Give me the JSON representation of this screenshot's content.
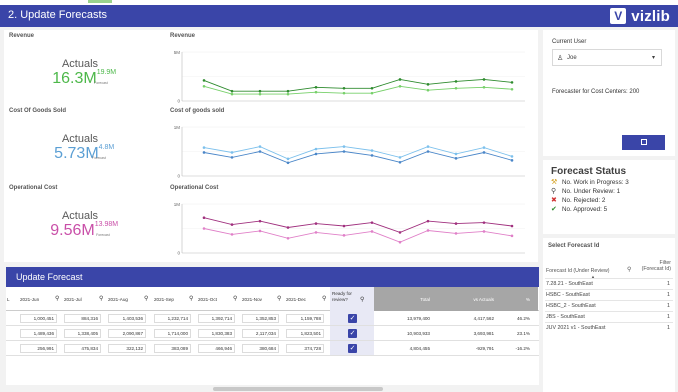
{
  "header": {
    "title": "2. Update Forecasts",
    "logo_text": "vizlib",
    "logo_glyph": "V"
  },
  "kpis": [
    {
      "section": "Revenue",
      "caption": "Actuals",
      "value": "16.3M",
      "forecast": "19.9M",
      "forecast_label": "Forecast",
      "color": "#4db84a"
    },
    {
      "section": "Cost Of Goods Sold",
      "caption": "Actuals",
      "value": "5.73M",
      "forecast": "4.8M",
      "forecast_label": "Forecast",
      "color": "#5b9fd4"
    },
    {
      "section": "Operational Cost",
      "caption": "Actuals",
      "value": "9.56M",
      "forecast": "13.98M",
      "forecast_label": "Forecast",
      "color": "#c94fa8"
    }
  ],
  "chart_data": [
    {
      "type": "line",
      "title": "Revenue",
      "ytick_top": "5M",
      "ytick_bottom": "0",
      "ylim": [
        0,
        5
      ],
      "series": [
        {
          "values": [
            2.1,
            1.0,
            1.0,
            1.0,
            1.4,
            1.3,
            1.3,
            2.2,
            1.7,
            2.0,
            2.2,
            1.9
          ],
          "color": "#2e8b2e"
        },
        {
          "values": [
            1.5,
            0.7,
            0.7,
            0.7,
            0.9,
            0.8,
            0.8,
            1.5,
            1.1,
            1.3,
            1.4,
            1.2
          ],
          "color": "#77d06a"
        }
      ]
    },
    {
      "type": "line",
      "title": "Cost of goods sold",
      "ytick_top": "1M",
      "ytick_bottom": "0",
      "ylim": [
        0,
        1
      ],
      "series": [
        {
          "values": [
            0.58,
            0.48,
            0.6,
            0.35,
            0.55,
            0.6,
            0.52,
            0.38,
            0.6,
            0.45,
            0.58,
            0.4
          ],
          "color": "#7cc0ec"
        },
        {
          "values": [
            0.48,
            0.38,
            0.5,
            0.27,
            0.45,
            0.5,
            0.42,
            0.28,
            0.5,
            0.36,
            0.48,
            0.32
          ],
          "color": "#4a86c8"
        }
      ]
    },
    {
      "type": "line",
      "title": "Operational Cost",
      "ytick_top": "1M",
      "ytick_bottom": "0",
      "ylim": [
        0,
        1
      ],
      "series": [
        {
          "values": [
            0.72,
            0.58,
            0.65,
            0.52,
            0.6,
            0.55,
            0.62,
            0.42,
            0.65,
            0.6,
            0.62,
            0.55
          ],
          "color": "#a0307e"
        },
        {
          "values": [
            0.5,
            0.38,
            0.45,
            0.3,
            0.42,
            0.36,
            0.44,
            0.22,
            0.46,
            0.4,
            0.44,
            0.35
          ],
          "color": "#e080c8"
        }
      ]
    }
  ],
  "side": {
    "current_user_label": "Current User",
    "user": "Joe",
    "forecaster_text": "Forecaster for Cost Centers: 200"
  },
  "forecast_status": {
    "title": "Forecast Status",
    "items": [
      {
        "icon": "work-in-progress-icon",
        "glyph": "⚒",
        "text": "No. Work in Progress: 3",
        "color": "#d4a020"
      },
      {
        "icon": "under-review-icon",
        "glyph": "⚲",
        "text": "No. Under Review: 1",
        "color": "#444"
      },
      {
        "icon": "rejected-icon",
        "glyph": "✖",
        "text": "No. Rejected: 2",
        "color": "#d03030"
      },
      {
        "icon": "approved-icon",
        "glyph": "✔",
        "text": "No. Approved: 5",
        "color": "#2e8b2e"
      }
    ]
  },
  "select_forecast": {
    "title": "Select Forecast Id",
    "col1": "Forecast Id (Under Review)",
    "col2a": "Filter",
    "col2b": "(Forecast Id)",
    "rows": [
      {
        "id": "7.28.21 - SouthEast",
        "filter": "1"
      },
      {
        "id": "HSBC - SouthEast",
        "filter": "1"
      },
      {
        "id": "HSBC_2 - SouthEast",
        "filter": "1"
      },
      {
        "id": "JBS - SouthEast",
        "filter": "1"
      },
      {
        "id": "JUV 2021 v1 - SouthEast",
        "filter": "1"
      }
    ]
  },
  "update_forecast": {
    "title": "Update Forecast",
    "columns": [
      "2021-Jun",
      "2021-Jul",
      "2021-Aug",
      "2021-Sep",
      "2021-Oct",
      "2021-Nov",
      "2021-Dec",
      "Ready for review?",
      "Total",
      "vs Actuals",
      "%"
    ],
    "leading": "L",
    "rows": [
      [
        "1,000,451",
        "884,316",
        "1,403,536",
        "1,232,714",
        "1,392,714",
        "1,352,853",
        "1,159,788",
        "",
        "13,979,400",
        "4,417,562",
        "46.2%"
      ],
      [
        "1,489,436",
        "1,338,405",
        "2,090,867",
        "1,714,000",
        "1,830,383",
        "2,117,034",
        "1,823,501",
        "",
        "10,903,933",
        "3,693,981",
        "23.1%"
      ],
      [
        "256,991",
        "475,834",
        "322,132",
        "383,089",
        "466,946",
        "380,684",
        "374,728",
        "",
        "4,804,455",
        "-929,791",
        "-16.2%"
      ]
    ]
  },
  "colors": {
    "accent": "#3a45a8"
  }
}
